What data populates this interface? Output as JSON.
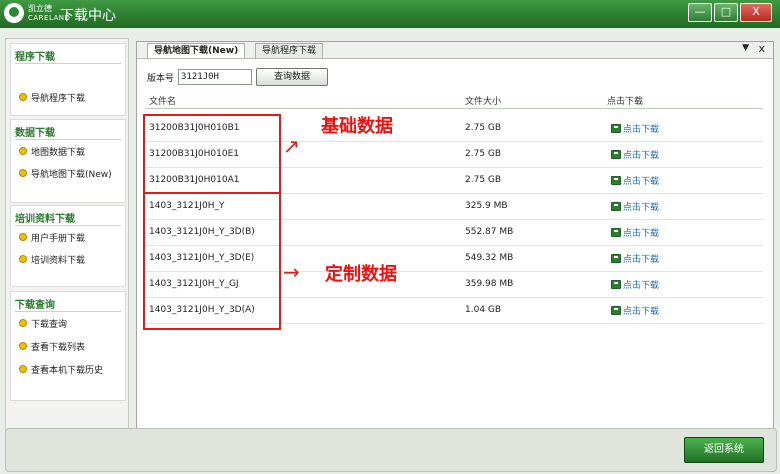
{
  "titlebar": {
    "brand_top": "凯立德",
    "brand_bottom": "CARELAND",
    "title": "下载中心",
    "minimize": "—",
    "restore": "□",
    "close": "X"
  },
  "sidebar": {
    "program": {
      "title": "程序下载",
      "items": [
        "导航程序下载"
      ]
    },
    "data": {
      "title": "数据下载",
      "items": [
        "地图数据下载",
        "导航地图下载(New)"
      ]
    },
    "training": {
      "title": "培训资料下载",
      "items": [
        "用户手册下载",
        "培训资料下载"
      ]
    },
    "query": {
      "title": "下载查询",
      "items": [
        "下载查询",
        "查看下载列表",
        "查看本机下载历史"
      ]
    }
  },
  "main": {
    "tabs": [
      "导航地图下载(New)",
      "导航程序下载"
    ],
    "tab_menu": "▼",
    "tab_close": "x",
    "version_label": "版本号",
    "version_value": "3121J0H",
    "search_button": "查询数据",
    "columns": {
      "filename": "文件名",
      "size": "文件大小",
      "download": "点击下载"
    },
    "rows": [
      {
        "name": "31200B31J0H010B1",
        "size": "2.75 GB",
        "action": "点击下载"
      },
      {
        "name": "31200B31J0H010E1",
        "size": "2.75 GB",
        "action": "点击下载"
      },
      {
        "name": "31200B31J0H010A1",
        "size": "2.75 GB",
        "action": "点击下载"
      },
      {
        "name": "1403_3121J0H_Y",
        "size": "325.9 MB",
        "action": "点击下载"
      },
      {
        "name": "1403_3121J0H_Y_3D(B)",
        "size": "552.87 MB",
        "action": "点击下载"
      },
      {
        "name": "1403_3121J0H_Y_3D(E)",
        "size": "549.32 MB",
        "action": "点击下载"
      },
      {
        "name": "1403_3121J0H_Y_GJ",
        "size": "359.98 MB",
        "action": "点击下载"
      },
      {
        "name": "1403_3121J0H_Y_3D(A)",
        "size": "1.04 GB",
        "action": "点击下载"
      }
    ],
    "annotations": {
      "basic": "基础数据",
      "custom": "定制数据"
    }
  },
  "footer": {
    "back_button": "返回系统"
  },
  "colors": {
    "brand_green": "#2f7d32",
    "annotation_red": "#d62020"
  }
}
